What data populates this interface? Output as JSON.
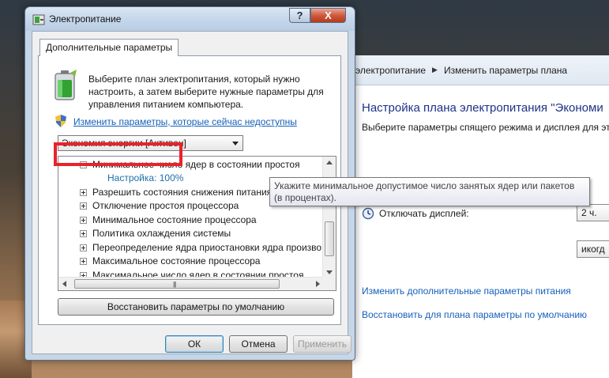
{
  "background_window": {
    "breadcrumb": [
      "электропитание",
      "Изменить параметры плана"
    ],
    "heading": "Настройка плана электропитания \"Экономи",
    "subheading": "Выберите параметры спящего режима и дисплея для эт",
    "display_off_label": "Отключать дисплей:",
    "display_off_value": "2 ч.",
    "sleep_value": "икогд",
    "link_advanced": "Изменить дополнительные параметры питания",
    "link_restore_defaults": "Восстановить для плана параметры по умолчанию"
  },
  "dialog": {
    "title": "Электропитание",
    "help_label": "?",
    "close_label": "X",
    "tab_label": "Дополнительные параметры",
    "intro_text": "Выберите план электропитания, который нужно настроить, а затем выберите нужные параметры для управления питанием компьютера.",
    "uac_link": "Изменить параметры, которые сейчас недоступны",
    "plan_selected": "Экономия энергии [Активен]",
    "tree_items": [
      {
        "label": "Минимальное число ядер в состоянии простоя",
        "expanded": true
      },
      {
        "label": "Настройка: 100%",
        "is_setting": true
      },
      {
        "label": "Разрешить состояния снижения питания",
        "expanded": false
      },
      {
        "label": "Отключение простоя процессора",
        "expanded": false
      },
      {
        "label": "Минимальное состояние процессора",
        "expanded": false
      },
      {
        "label": "Политика охлаждения системы",
        "expanded": false
      },
      {
        "label": "Переопределение ядра приостановки ядра произво,",
        "expanded": false
      },
      {
        "label": "Максимальное состояние процессора",
        "expanded": false
      },
      {
        "label": "Максимальное число ядер в состоянии простоя",
        "expanded": false
      }
    ],
    "restore_button": "Восстановить параметры по умолчанию",
    "ok_button": "ОК",
    "cancel_button": "Отмена",
    "apply_button": "Применить"
  },
  "tooltip": "Укажите минимальное допустимое число занятых ядер или пакетов (в процентах).",
  "colors": {
    "link": "#1660b8",
    "highlight_box": "#e8232a",
    "setting_text": "#1c6fa8",
    "heading_blue": "#1e3287"
  }
}
